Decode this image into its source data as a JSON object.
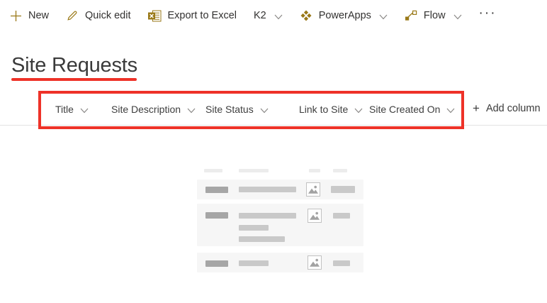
{
  "colors": {
    "accent_gold": "#9a7918",
    "annotation_red": "#ee3228",
    "command_text": "#323130",
    "header_text": "#3e3e3e",
    "skeleton_row_bg": "#f6f6f6",
    "skeleton_bar_dark": "#a6a6a6",
    "skeleton_bar_light": "#c9c9c9"
  },
  "command_bar": {
    "items": [
      {
        "label": "New",
        "icon": "plus-icon",
        "has_chevron": false
      },
      {
        "label": "Quick edit",
        "icon": "pencil-icon",
        "has_chevron": false
      },
      {
        "label": "Export to Excel",
        "icon": "excel-icon",
        "has_chevron": false
      },
      {
        "label": "K2",
        "icon": null,
        "has_chevron": true
      },
      {
        "label": "PowerApps",
        "icon": "powerapps-icon",
        "has_chevron": true
      },
      {
        "label": "Flow",
        "icon": "flow-icon",
        "has_chevron": true
      },
      {
        "label": "···",
        "icon": "ellipsis-icon",
        "has_chevron": false
      }
    ]
  },
  "page": {
    "title": "Site Requests"
  },
  "list_header": {
    "columns": [
      {
        "label": "Title"
      },
      {
        "label": "Site Description"
      },
      {
        "label": "Site Status"
      },
      {
        "label": "Link to Site"
      },
      {
        "label": "Site Created On"
      }
    ],
    "add_column_plus": "+",
    "add_column_label": "Add column"
  },
  "skeleton": {
    "placeholder_rows": 3
  }
}
